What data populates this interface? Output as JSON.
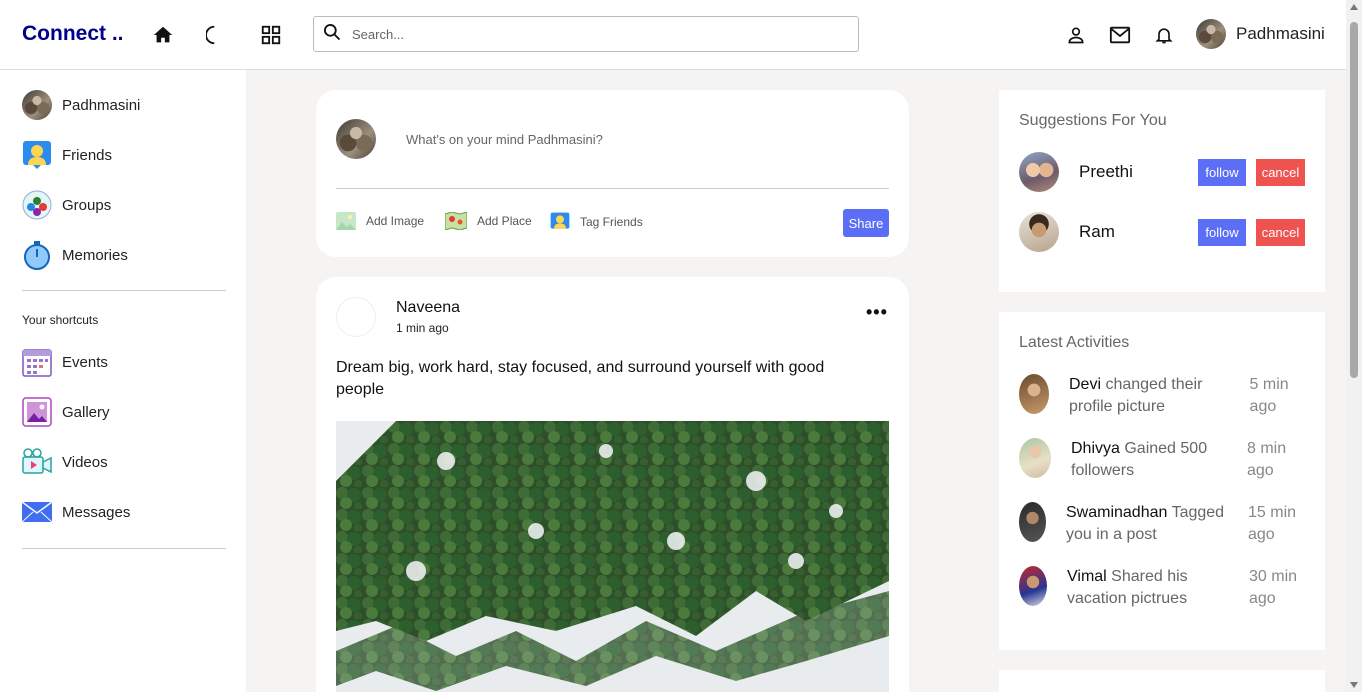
{
  "nav": {
    "logo": "Connect ..",
    "search_placeholder": "Search...",
    "user_name": "Padhmasini"
  },
  "sidebar": {
    "items": [
      {
        "label": "Padhmasini"
      },
      {
        "label": "Friends"
      },
      {
        "label": "Groups"
      },
      {
        "label": "Memories"
      }
    ],
    "shortcuts_title": "Your shortcuts",
    "shortcuts": [
      {
        "label": "Events"
      },
      {
        "label": "Gallery"
      },
      {
        "label": "Videos"
      },
      {
        "label": "Messages"
      }
    ]
  },
  "share": {
    "placeholder": "What's on your mind Padhmasini?",
    "add_image": "Add Image",
    "add_place": "Add Place",
    "tag_friends": "Tag Friends",
    "share_label": "Share"
  },
  "post": {
    "author": "Naveena",
    "time": "1 min ago",
    "text": "Dream big, work hard, stay focused, and surround yourself with good people"
  },
  "suggestions": {
    "title": "Suggestions For You",
    "follow_label": "follow",
    "cancel_label": "cancel",
    "users": [
      {
        "name": "Preethi"
      },
      {
        "name": "Ram"
      }
    ]
  },
  "activities": {
    "title": "Latest Activities",
    "items": [
      {
        "user": "Devi",
        "action": " changed their profile picture",
        "time": "5 min ago"
      },
      {
        "user": "Dhivya",
        "action": " Gained 500 followers",
        "time": "8 min ago"
      },
      {
        "user": "Swaminadhan",
        "action": " Tagged you in a post",
        "time": "15 min ago"
      },
      {
        "user": "Vimal",
        "action": " Shared his vacation pictrues",
        "time": "30 min ago"
      }
    ]
  },
  "colors": {
    "brand": "#00008b",
    "follow": "#5b6ef5",
    "cancel": "#ef5350"
  }
}
